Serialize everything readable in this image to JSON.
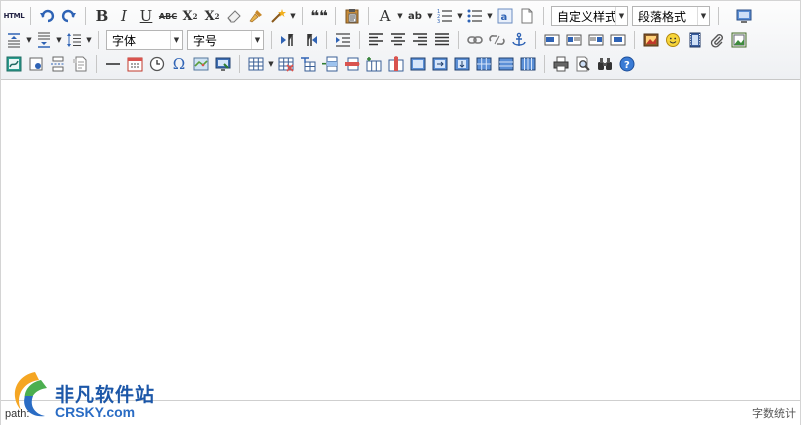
{
  "toolbar": {
    "html_label": "HTML",
    "bold": "B",
    "italic": "I",
    "underline": "U",
    "strike": "ABC",
    "superscript_base": "X",
    "superscript_mark": "2",
    "subscript_base": "X",
    "subscript_mark": "2",
    "quote": "❝❝",
    "font_color": "A",
    "highlight": "ab",
    "custom_style": "自定义样式",
    "paragraph_format": "段落格式",
    "font_family": "字体",
    "font_size": "字号",
    "special_char": "Ω"
  },
  "statusbar": {
    "path_label": "path:",
    "word_count_label": "字数统计"
  },
  "watermark": {
    "cn": "非凡软件站",
    "en": "CRSKY.com"
  },
  "colors": {
    "accent": "#2a6cc4",
    "icon_blue": "#2f63b5",
    "toolbar_bg": "#eef0f3"
  }
}
